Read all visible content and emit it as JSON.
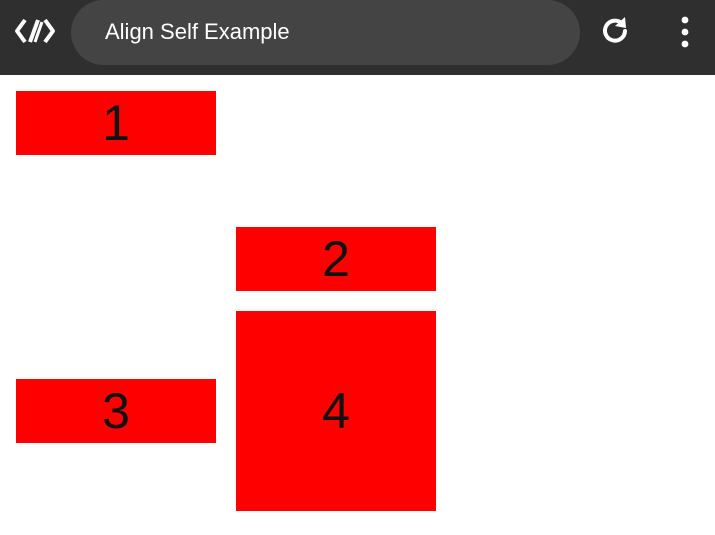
{
  "toolbar": {
    "title": "Align Self Example",
    "icons": {
      "app": "code-brackets-icon",
      "reload": "refresh-icon",
      "more": "more-vert-icon"
    },
    "colors": {
      "bar": "#2f2f2f",
      "address_pill": "#444444",
      "icon": "#ffffff"
    }
  },
  "boxes": [
    {
      "label": "1"
    },
    {
      "label": "2"
    },
    {
      "label": "3"
    },
    {
      "label": "4"
    }
  ],
  "colors": {
    "box": "#ff0000",
    "box_text": "#111111",
    "background": "#ffffff"
  }
}
